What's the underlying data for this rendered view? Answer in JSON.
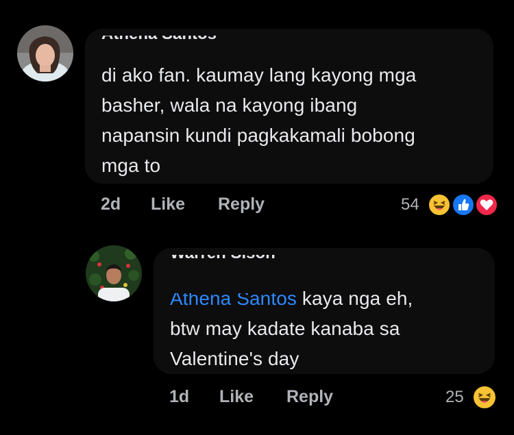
{
  "comment1": {
    "author": "Athena Santos",
    "text_lines": [
      "di ako fan. kaumay lang kayong mga",
      "basher, wala na kayong ibang",
      "napansin kundi pagkakamali bobong",
      "mga to"
    ],
    "time": "2d",
    "like_label": "Like",
    "reply_label": "Reply",
    "reaction_count": "54",
    "reaction_icons": [
      "haha-icon",
      "like-icon",
      "love-icon"
    ]
  },
  "reply1": {
    "author": "Warren Sison",
    "mention": "Athena Santos",
    "text_first": " kaya nga eh,",
    "text_lines": [
      "btw may kadate kanaba sa",
      "Valentine's day"
    ],
    "time": "1d",
    "like_label": "Like",
    "reply_label": "Reply",
    "reaction_count": "25",
    "reaction_icons": [
      "haha-icon"
    ]
  },
  "colors": {
    "background": "#000000",
    "bubble": "#0d0d0d",
    "text": "#e9eaed",
    "meta": "#b0b3b8",
    "mention": "#2d88ff",
    "haha": "#f7c234",
    "like": "#1877f2",
    "love": "#f0284a"
  }
}
